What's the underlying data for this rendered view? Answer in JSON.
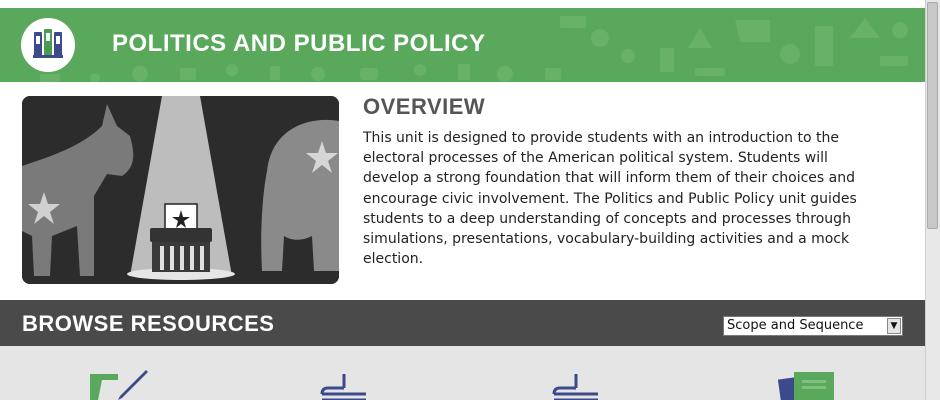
{
  "header": {
    "title": "POLITICS AND PUBLIC POLICY",
    "logo_icon": "ballot-logo-icon",
    "bg_color": "#5aa85b"
  },
  "overview": {
    "heading": "OVERVIEW",
    "image_icon": "donkey-elephant-ballot-box-illustration",
    "body": "This unit is designed to provide students with an introduction to the electoral processes of the American political system. Students will develop a strong foundation that will inform them of their choices and encourage civic involvement. The Politics and Public Policy unit guides students to a deep understanding of concepts and processes through simulations, presentations, vocabulary-building activities and a mock election."
  },
  "browse": {
    "heading": "BROWSE RESOURCES",
    "bg_color": "#4a4a4a",
    "select": {
      "selected": "Scope and Sequence"
    }
  },
  "resources": {
    "icons": [
      "scroll-pen-icon",
      "document-icon",
      "document-icon",
      "papers-stack-icon"
    ]
  }
}
